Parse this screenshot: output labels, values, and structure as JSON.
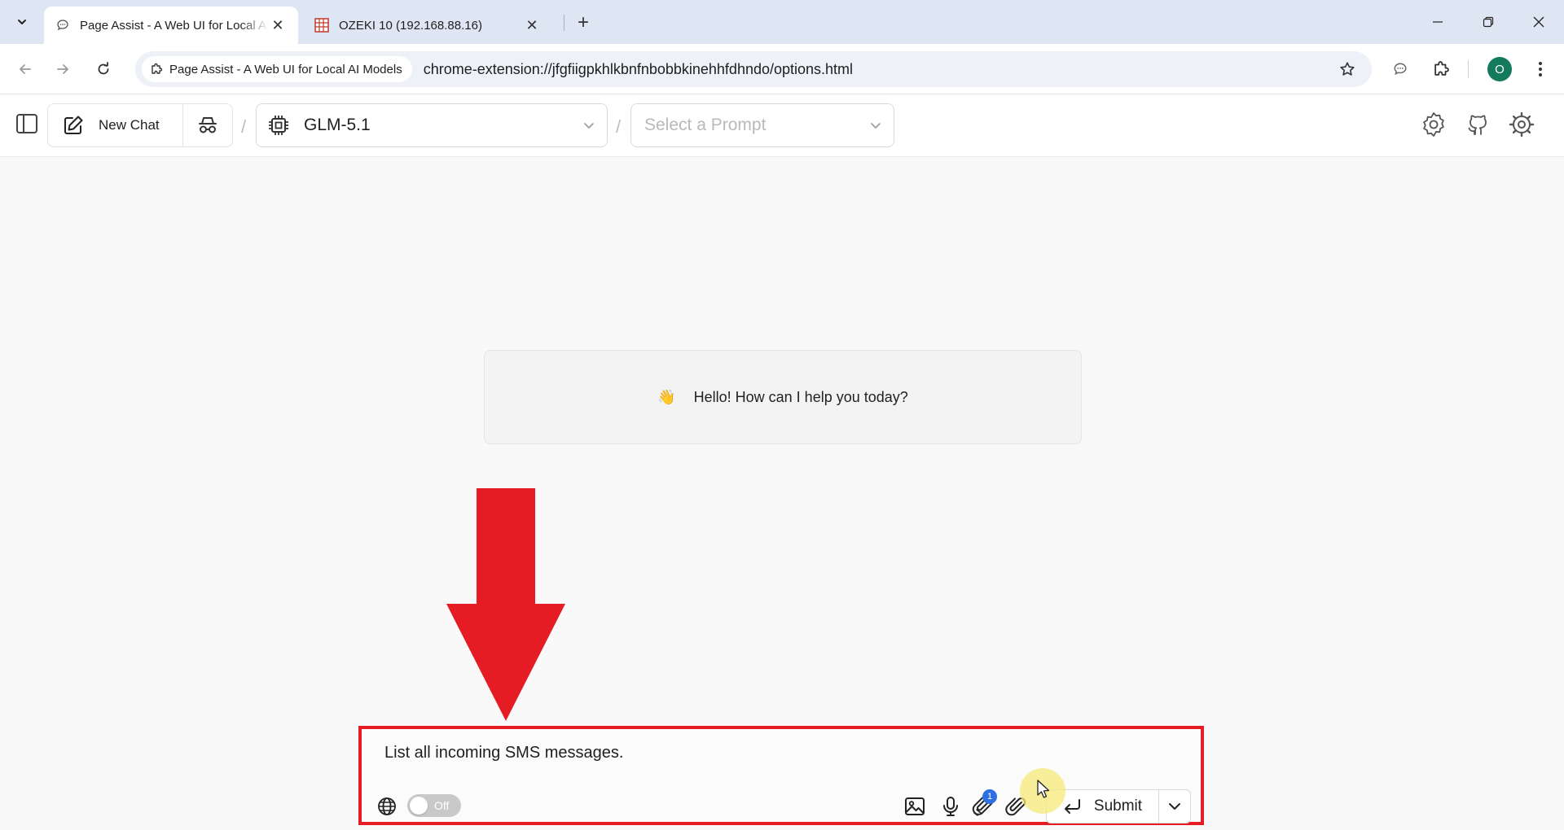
{
  "browser": {
    "tabs": [
      {
        "title": "Page Assist - A Web UI for Local AI Models",
        "active": true
      },
      {
        "title": "OZEKI 10 (192.168.88.16)",
        "active": false
      }
    ],
    "site_chip": "Page Assist - A Web UI for Local AI Models",
    "url": "chrome-extension://jfgfiigpkhlkbnfnbobbkinehhfdhndo/options.html",
    "profile_initial": "O"
  },
  "header": {
    "new_chat_label": "New Chat",
    "model_label": "GLM-5.1",
    "prompt_placeholder": "Select a Prompt",
    "separator": "/"
  },
  "main": {
    "greeting_emoji": "👋",
    "greeting_text": "Hello! How can I help you today?"
  },
  "composer": {
    "message": "List all incoming SMS messages.",
    "web_search_state": "Off",
    "knowledge_badge": "1",
    "submit_label": "Submit"
  },
  "colors": {
    "annotation_red": "#e51c24",
    "profile_green": "#137a5c",
    "badge_blue": "#2f6fe4"
  }
}
